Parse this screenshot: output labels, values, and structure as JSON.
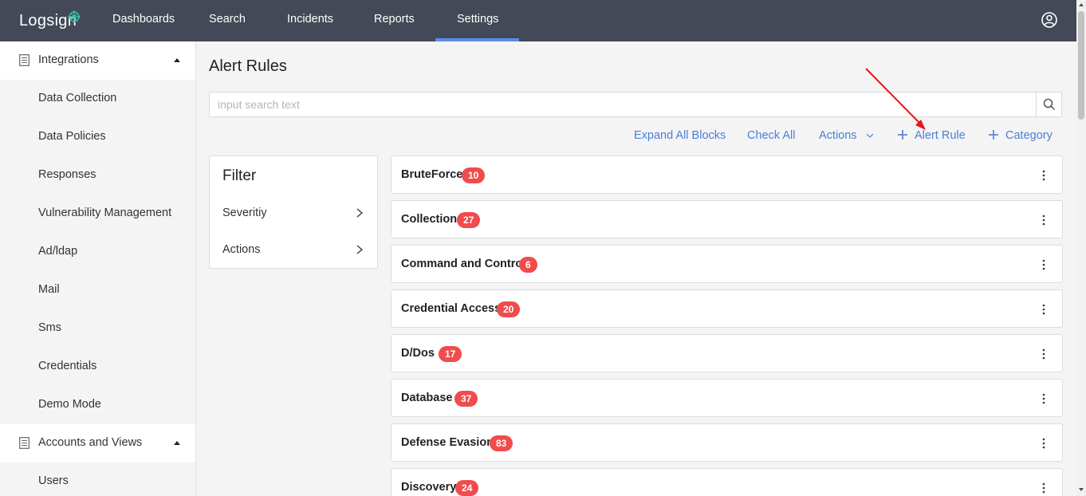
{
  "brand": {
    "name": "Logsign",
    "accent": "#5b8de6",
    "topbar_bg": "#434956",
    "link": "#4a7fd6",
    "badge": "#f04c4c"
  },
  "nav": [
    {
      "label": "Dashboards"
    },
    {
      "label": "Search"
    },
    {
      "label": "Incidents"
    },
    {
      "label": "Reports"
    },
    {
      "label": "Settings",
      "active": true
    }
  ],
  "sidebar": {
    "groups": [
      {
        "label": "Integrations",
        "icon": "list-icon",
        "expanded": true,
        "items": [
          "Data Collection",
          "Data Policies",
          "Responses",
          "Vulnerability Management",
          "Ad/ldap",
          "Mail",
          "Sms",
          "Credentials",
          "Demo Mode"
        ]
      },
      {
        "label": "Accounts and Views",
        "icon": "list-icon",
        "expanded": true,
        "items": [
          "Users"
        ]
      }
    ]
  },
  "main": {
    "title": "Alert Rules",
    "search": {
      "placeholder": "input search text",
      "value": ""
    },
    "toolbar": {
      "expand_all": "Expand All Blocks",
      "check_all": "Check All",
      "actions": "Actions",
      "add_rule": "Alert Rule",
      "add_category": "Category"
    },
    "filter": {
      "title": "Filter",
      "rows": [
        "Severitiy",
        "Actions"
      ]
    },
    "categories": [
      {
        "name": "BruteForce",
        "count": "10"
      },
      {
        "name": "Collection",
        "count": "27"
      },
      {
        "name": "Command and Control",
        "count": "6"
      },
      {
        "name": "Credential Access",
        "count": "20"
      },
      {
        "name": "D/Dos",
        "count": "17"
      },
      {
        "name": "Database",
        "count": "37"
      },
      {
        "name": "Defense Evasion",
        "count": "83"
      },
      {
        "name": "Discovery",
        "count": "24"
      }
    ]
  }
}
